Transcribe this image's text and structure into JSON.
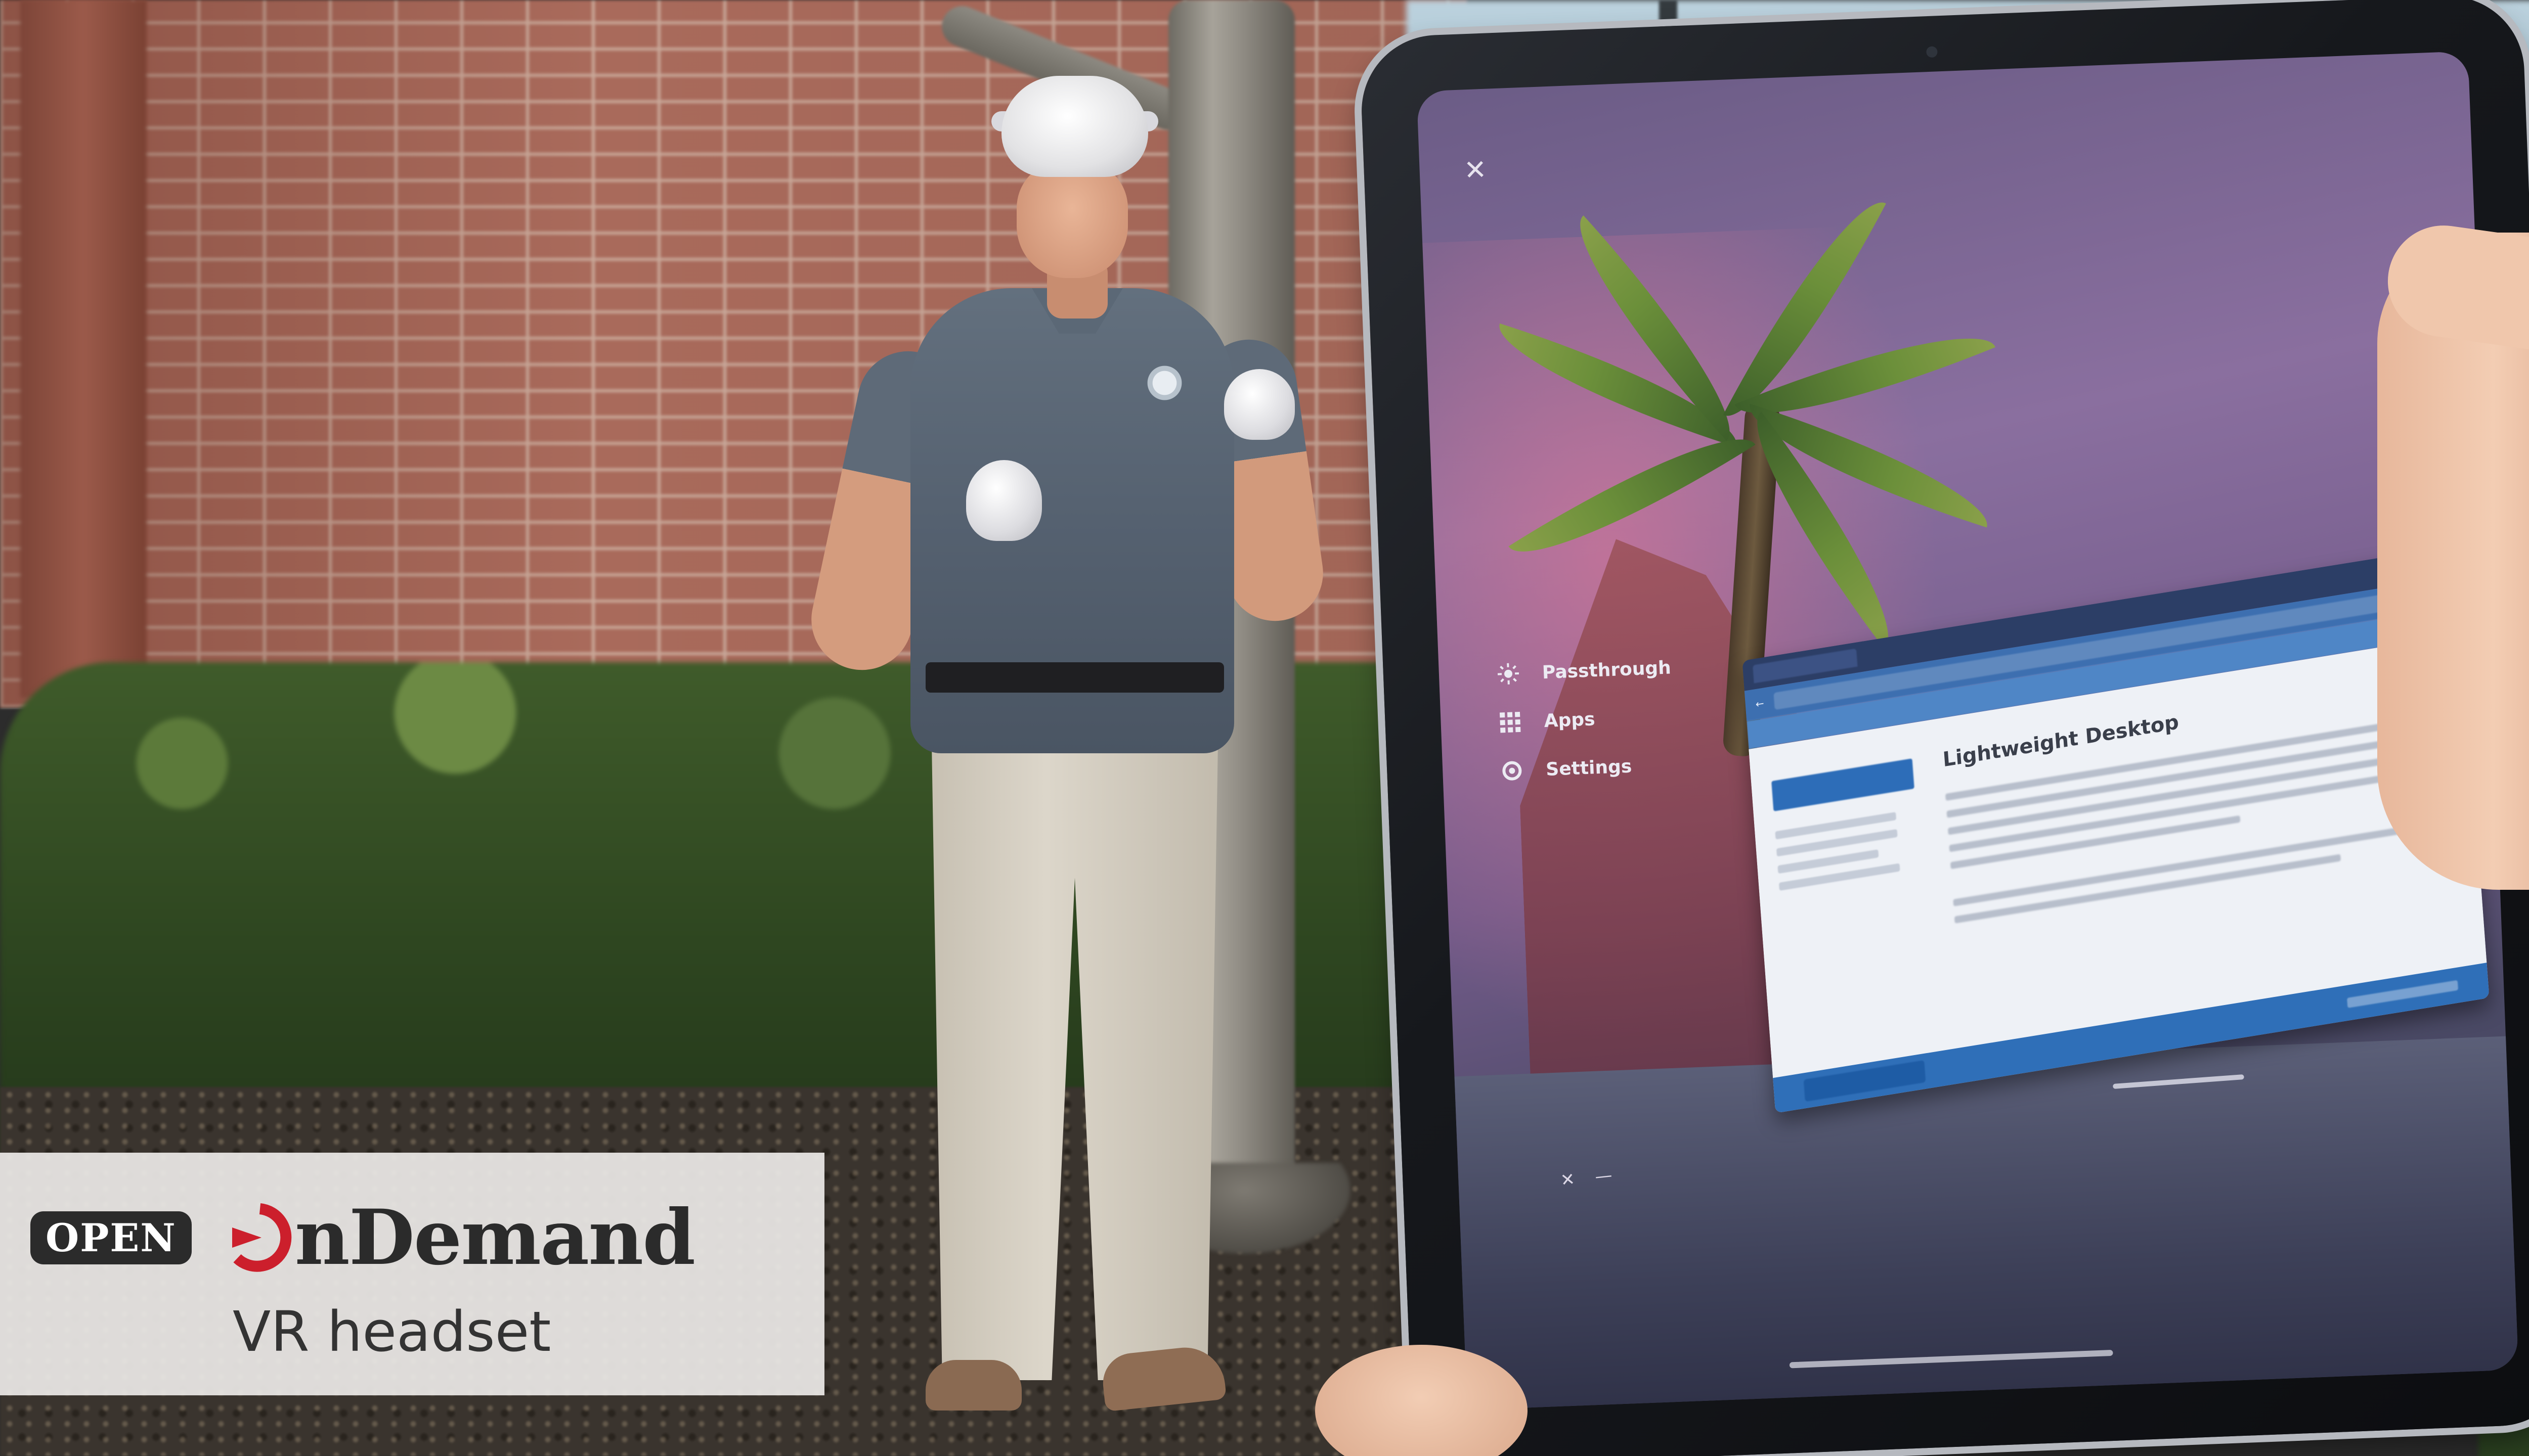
{
  "overlay": {
    "badge": "OPEN",
    "brand": "nDemand",
    "subtitle": "VR headset",
    "accent_color": "#cc1f2c"
  },
  "tablet": {
    "vr_menu": {
      "items": [
        {
          "label": "Passthrough",
          "icon": "passthrough-icon"
        },
        {
          "label": "Apps",
          "icon": "apps-grid-icon"
        },
        {
          "label": "Settings",
          "icon": "gear-icon"
        }
      ]
    },
    "browser": {
      "heading": "Lightweight Desktop"
    }
  }
}
